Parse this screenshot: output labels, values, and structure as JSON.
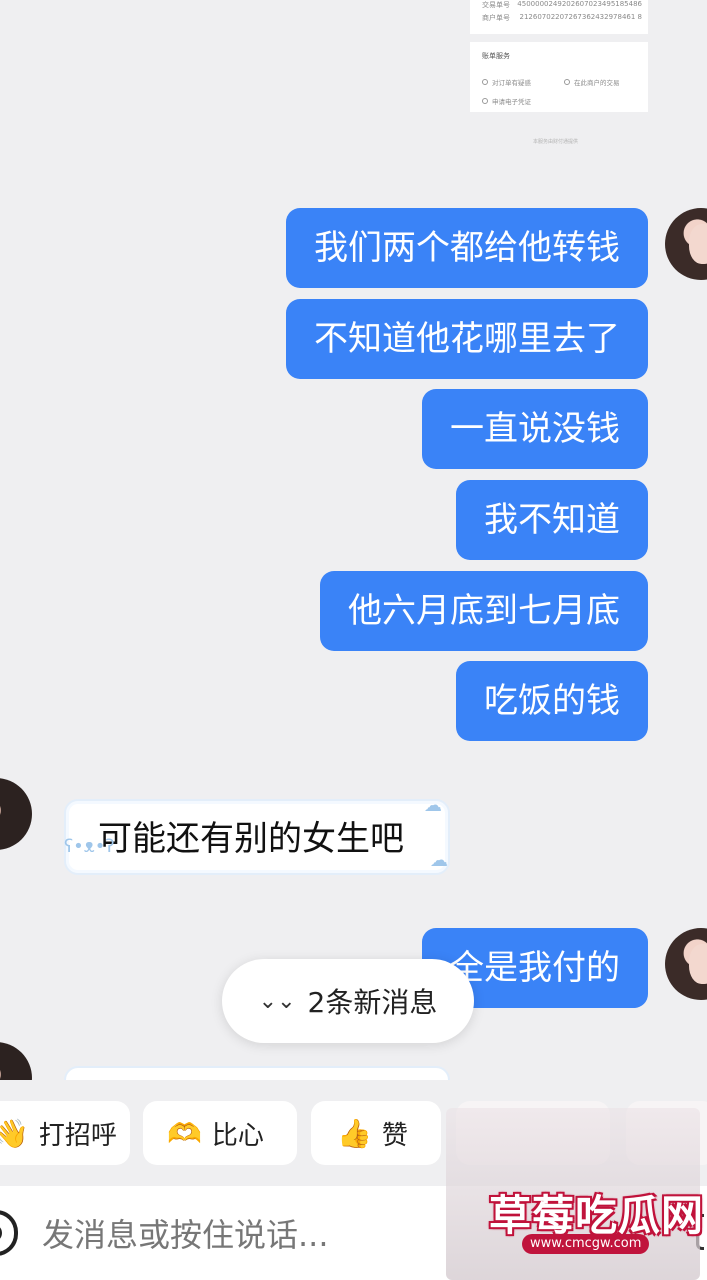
{
  "receipt": {
    "rows": [
      {
        "label": "交易单号",
        "value": "4500000249202607023495185486"
      },
      {
        "label": "商户单号",
        "value": "21260702207267362432978461 8"
      }
    ],
    "section_title": "账单服务",
    "services": [
      "对订单有疑惑",
      "在此商户的交易",
      "申请电子凭证"
    ],
    "footer": "本服务由财付通提供"
  },
  "messages_right": [
    "我们两个都给他转钱",
    "不知道他花哪里去了",
    "一直说没钱",
    "我不知道",
    "他六月底到七月底",
    "吃饭的钱"
  ],
  "message_left": "可能还有别的女生吧",
  "message_right_partial": "全是我付的",
  "new_messages_pill": "2条新消息",
  "quick_replies": [
    {
      "label": "打招呼",
      "icon": "wave-hand-icon",
      "glyph": "👋"
    },
    {
      "label": "比心",
      "icon": "heart-hands-icon",
      "glyph": "🫶"
    },
    {
      "label": "赞",
      "icon": "thumbs-up-icon",
      "glyph": "👍"
    }
  ],
  "input": {
    "placeholder": "发消息或按住说话..."
  },
  "watermark": {
    "title": "草莓吃瓜网",
    "url": "www.cmcgw.com"
  },
  "colors": {
    "bubble_self": "#3a83f7",
    "background": "#efeff1",
    "watermark_red": "#c0143c"
  }
}
